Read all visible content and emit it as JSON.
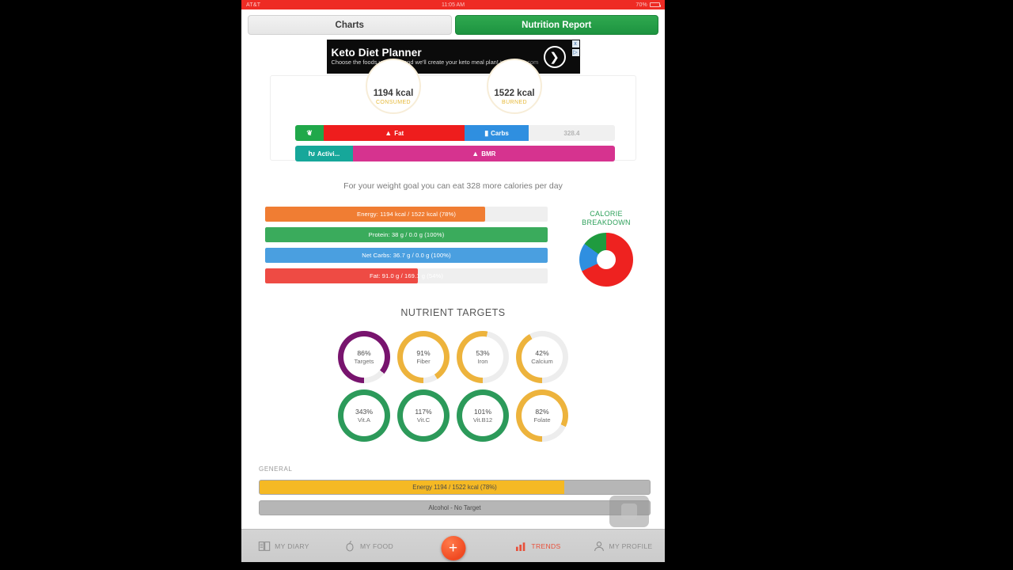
{
  "status_bar": {
    "carrier": "AT&T",
    "time": "11:05 AM",
    "battery": "70%"
  },
  "segmented_tabs": {
    "charts_label": "Charts",
    "nutrition_report_label": "Nutrition Report",
    "active": "Nutrition Report"
  },
  "ad": {
    "title": "Keto Diet Planner",
    "body": "Choose the foods you love, and we'll create your keto meal plan!",
    "url": "try.dietwiz.com",
    "arrow_icon": "chevron-right-icon",
    "close_icon": "x",
    "info_icon": "▷"
  },
  "summary": {
    "consumed": {
      "value": "1194 kcal",
      "label": "CONSUMED"
    },
    "burned": {
      "value": "1522 kcal",
      "label": "BURNED"
    },
    "intake_bar": [
      {
        "name": "Protein",
        "label": "",
        "icon": "leaf-icon",
        "pct": 9,
        "color": "#20a84a"
      },
      {
        "name": "Fat",
        "label": "Fat",
        "icon": "flame-icon",
        "pct": 44,
        "color": "#ee1d1d"
      },
      {
        "name": "Carbs",
        "label": "Carbs",
        "icon": "droplet-icon",
        "pct": 20,
        "color": "#2f8fe0"
      },
      {
        "name": "Remaining",
        "label": "328.4",
        "icon": "",
        "pct": 27,
        "color": "#f0f0f0"
      }
    ],
    "burn_bar": [
      {
        "name": "Activity",
        "label": "Activi...",
        "icon": "person-icon",
        "pct": 18,
        "color": "#16a79a"
      },
      {
        "name": "BMR",
        "label": "BMR",
        "icon": "flame-icon",
        "pct": 82,
        "color": "#d6338f"
      }
    ]
  },
  "goal_note": "For your weight goal you can eat 328 more calories per day",
  "macros": [
    {
      "label": "Energy: 1194 kcal / 1522 kcal (78%)",
      "pct": 78,
      "color": "#f07d33",
      "name": "energy"
    },
    {
      "label": "Protein: 38 g / 0.0 g (100%)",
      "pct": 100,
      "color": "#3aab5c",
      "name": "protein"
    },
    {
      "label": "Net Carbs: 36.7 g / 0.0 g (100%)",
      "pct": 100,
      "color": "#4a9fe0",
      "name": "net-carbs"
    },
    {
      "label": "Fat: 91.0 g / 169.1 g (54%)",
      "pct": 54,
      "color": "#ee4b44",
      "name": "fat"
    }
  ],
  "calorie_breakdown": {
    "title_line1": "CALORIE",
    "title_line2": "BREAKDOWN",
    "slices": [
      {
        "name": "Fat",
        "pct": 68,
        "color": "#ee2220"
      },
      {
        "name": "Carbs",
        "pct": 17,
        "color": "#2f8fe0"
      },
      {
        "name": "Protein",
        "pct": 15,
        "color": "#1f9b3f"
      }
    ]
  },
  "nutrient_targets": {
    "title": "NUTRIENT TARGETS",
    "items": [
      {
        "pct": "86%",
        "name": "Targets",
        "value": 86,
        "color": "#78146e",
        "track": "#ededed"
      },
      {
        "pct": "91%",
        "name": "Fiber",
        "value": 91,
        "color": "#edb33c",
        "track": "#ededed"
      },
      {
        "pct": "53%",
        "name": "Iron",
        "value": 53,
        "color": "#edb33c",
        "track": "#ededed"
      },
      {
        "pct": "42%",
        "name": "Calcium",
        "value": 42,
        "color": "#edb33c",
        "track": "#ededed"
      },
      {
        "pct": "343%",
        "name": "Vit.A",
        "value": 100,
        "color": "#2c9a5a",
        "track": "#2c9a5a"
      },
      {
        "pct": "117%",
        "name": "Vit.C",
        "value": 100,
        "color": "#2c9a5a",
        "track": "#2c9a5a"
      },
      {
        "pct": "101%",
        "name": "Vit.B12",
        "value": 100,
        "color": "#2c9a5a",
        "track": "#2c9a5a"
      },
      {
        "pct": "82%",
        "name": "Folate",
        "value": 82,
        "color": "#edb33c",
        "track": "#ededed"
      }
    ]
  },
  "general": {
    "header": "GENERAL",
    "rows": [
      {
        "label": "Energy 1194 / 1522 kcal (78%)",
        "pct": 78,
        "fill": "#f5b924"
      },
      {
        "label": "Alcohol - No Target",
        "pct": 0,
        "fill": "#b6b6b6"
      }
    ]
  },
  "tabbar": {
    "items": [
      {
        "label": "MY DIARY",
        "icon": "book-icon",
        "active": false
      },
      {
        "label": "MY FOOD",
        "icon": "apple-icon",
        "active": false
      },
      {
        "label": "TRENDS",
        "icon": "bar-chart-icon",
        "active": true
      },
      {
        "label": "MY PROFILE",
        "icon": "person-icon",
        "active": false
      }
    ],
    "add_button": {
      "label": "+",
      "icon": "plus-icon"
    }
  }
}
